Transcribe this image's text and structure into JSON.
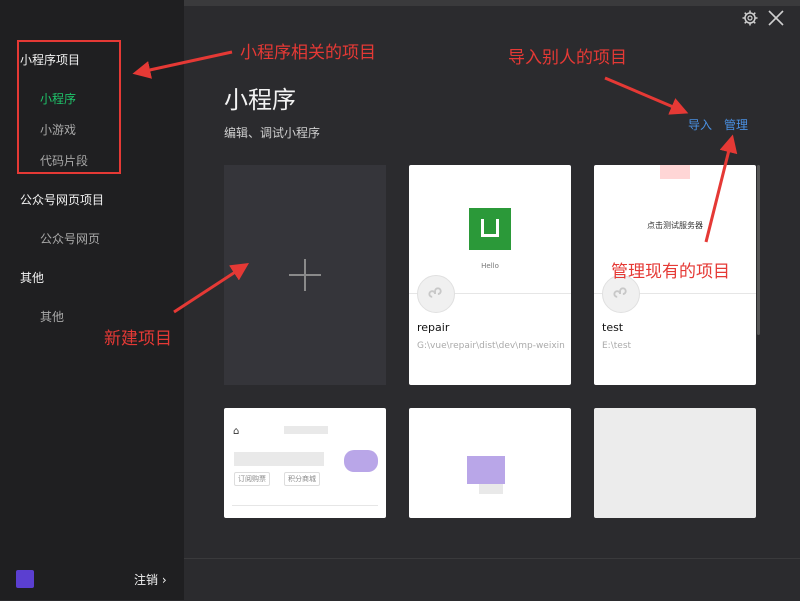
{
  "window": {
    "settings_icon": "gear-icon",
    "close_icon": "close-icon"
  },
  "sidebar": {
    "groups": [
      {
        "title": "小程序项目",
        "items": [
          "小程序",
          "小游戏",
          "代码片段"
        ]
      },
      {
        "title": "公众号网页项目",
        "items": [
          "公众号网页"
        ]
      },
      {
        "title": "其他",
        "items": [
          "其他"
        ]
      }
    ],
    "active_item": "小程序",
    "footer": {
      "logout_label": "注销"
    }
  },
  "main": {
    "title": "小程序",
    "subtitle": "编辑、调试小程序",
    "import_label": "导入",
    "manage_label": "管理",
    "projects": [
      {
        "name": "repair",
        "path": "G:\\vue\\repair\\dist\\dev\\mp-weixin",
        "preview_text": "Hello"
      },
      {
        "name": "test",
        "path": "E:\\test",
        "preview_text": "点击测试服务器"
      }
    ],
    "card3": {
      "tag1": "订阅购票",
      "tag2": "积分商城"
    }
  },
  "annotations": {
    "mini_program_related": "小程序相关的项目",
    "import_others": "导入别人的项目",
    "manage_existing": "管理现有的项目",
    "new_project": "新建项目"
  },
  "colors": {
    "accent": "#1fc36a",
    "link": "#4a90e2",
    "annotation": "#e53935"
  }
}
